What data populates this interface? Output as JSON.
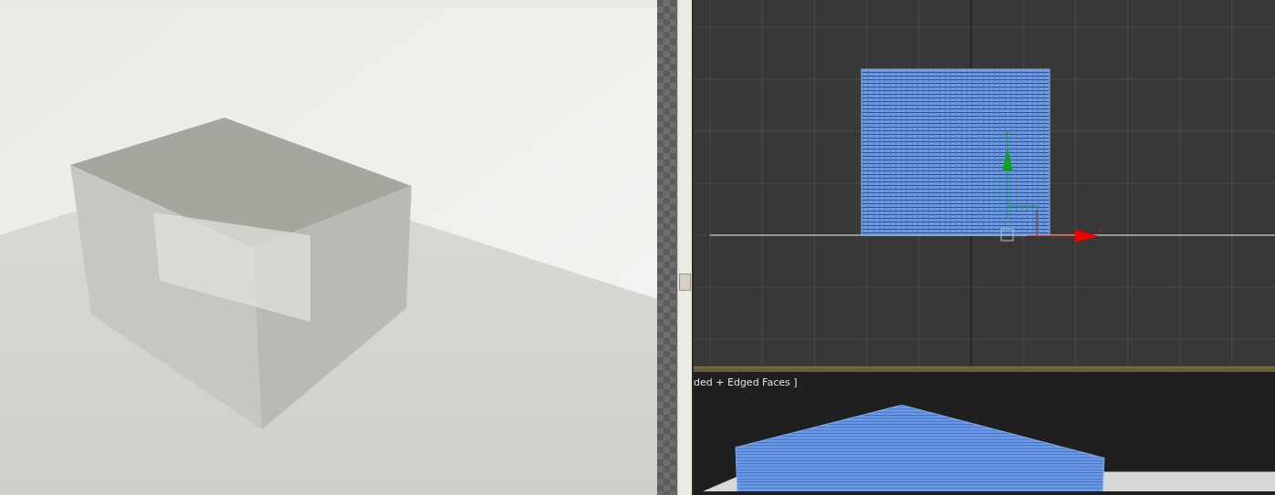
{
  "viewports": [
    {
      "kind": "front",
      "gizmo": {
        "y_label": "y",
        "x_label": "x"
      }
    },
    {
      "kind": "perspective",
      "label": "ded + Edged Faces ]"
    }
  ]
}
